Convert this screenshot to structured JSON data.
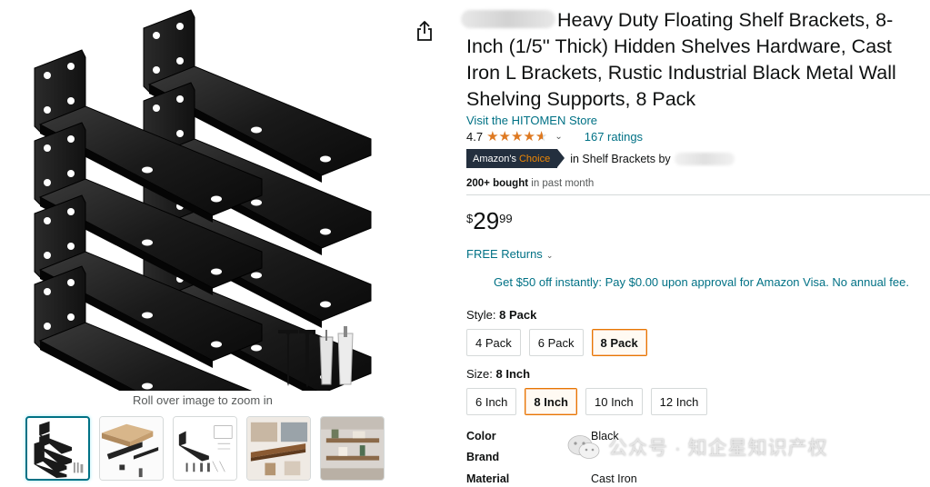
{
  "gallery": {
    "zoom_hint": "Roll over image to zoom in",
    "thumbnails": [
      {
        "name": "brackets-stack",
        "selected": true
      },
      {
        "name": "box-and-shelf"
      },
      {
        "name": "installation-diagram"
      },
      {
        "name": "shelf-scene"
      },
      {
        "name": "room-scene"
      }
    ]
  },
  "product": {
    "title": "Heavy Duty Floating Shelf Brackets, 8-Inch (1/5'' Thick) Hidden Shelves Hardware, Cast Iron L Brackets, Rustic Industrial Black Metal Wall Shelving Supports, 8 Pack",
    "store_link": "Visit the HITOMEN Store",
    "rating_value": "4.7",
    "rating_stars": 4.7,
    "rating_chevron": "⌄",
    "ratings_count": "167 ratings",
    "badge_text_1": "Amazon's",
    "badge_text_2": "Choice",
    "badge_suffix": "in Shelf Brackets by",
    "bought_bold": "200+ bought",
    "bought_rest": " in past month",
    "price_symbol": "$",
    "price_whole": "29",
    "price_fraction": "99",
    "returns": "FREE Returns",
    "returns_chevron": "⌄",
    "promo": "Get $50 off instantly: Pay $0.00 upon approval for Amazon Visa. No annual fee."
  },
  "style_selector": {
    "label": "Style: ",
    "selected_value": "8 Pack",
    "options": [
      "4 Pack",
      "6 Pack",
      "8 Pack"
    ],
    "selected_index": 2
  },
  "size_selector": {
    "label": "Size: ",
    "selected_value": "8 Inch",
    "options": [
      "6 Inch",
      "8 Inch",
      "10 Inch",
      "12 Inch"
    ],
    "selected_index": 1
  },
  "specs": [
    {
      "key": "Color",
      "value": "Black"
    },
    {
      "key": "Brand",
      "value": ""
    },
    {
      "key": "Material",
      "value": "Cast Iron"
    }
  ],
  "watermark": {
    "text": "公众号 · 知企星知识产权"
  },
  "icons": {
    "share": "share-icon",
    "star": "star-icon"
  },
  "colors": {
    "link": "#007185",
    "star": "#de7921",
    "badge_bg": "#232f3e",
    "badge_accent": "#f08804",
    "selected_border": "#e77600"
  }
}
